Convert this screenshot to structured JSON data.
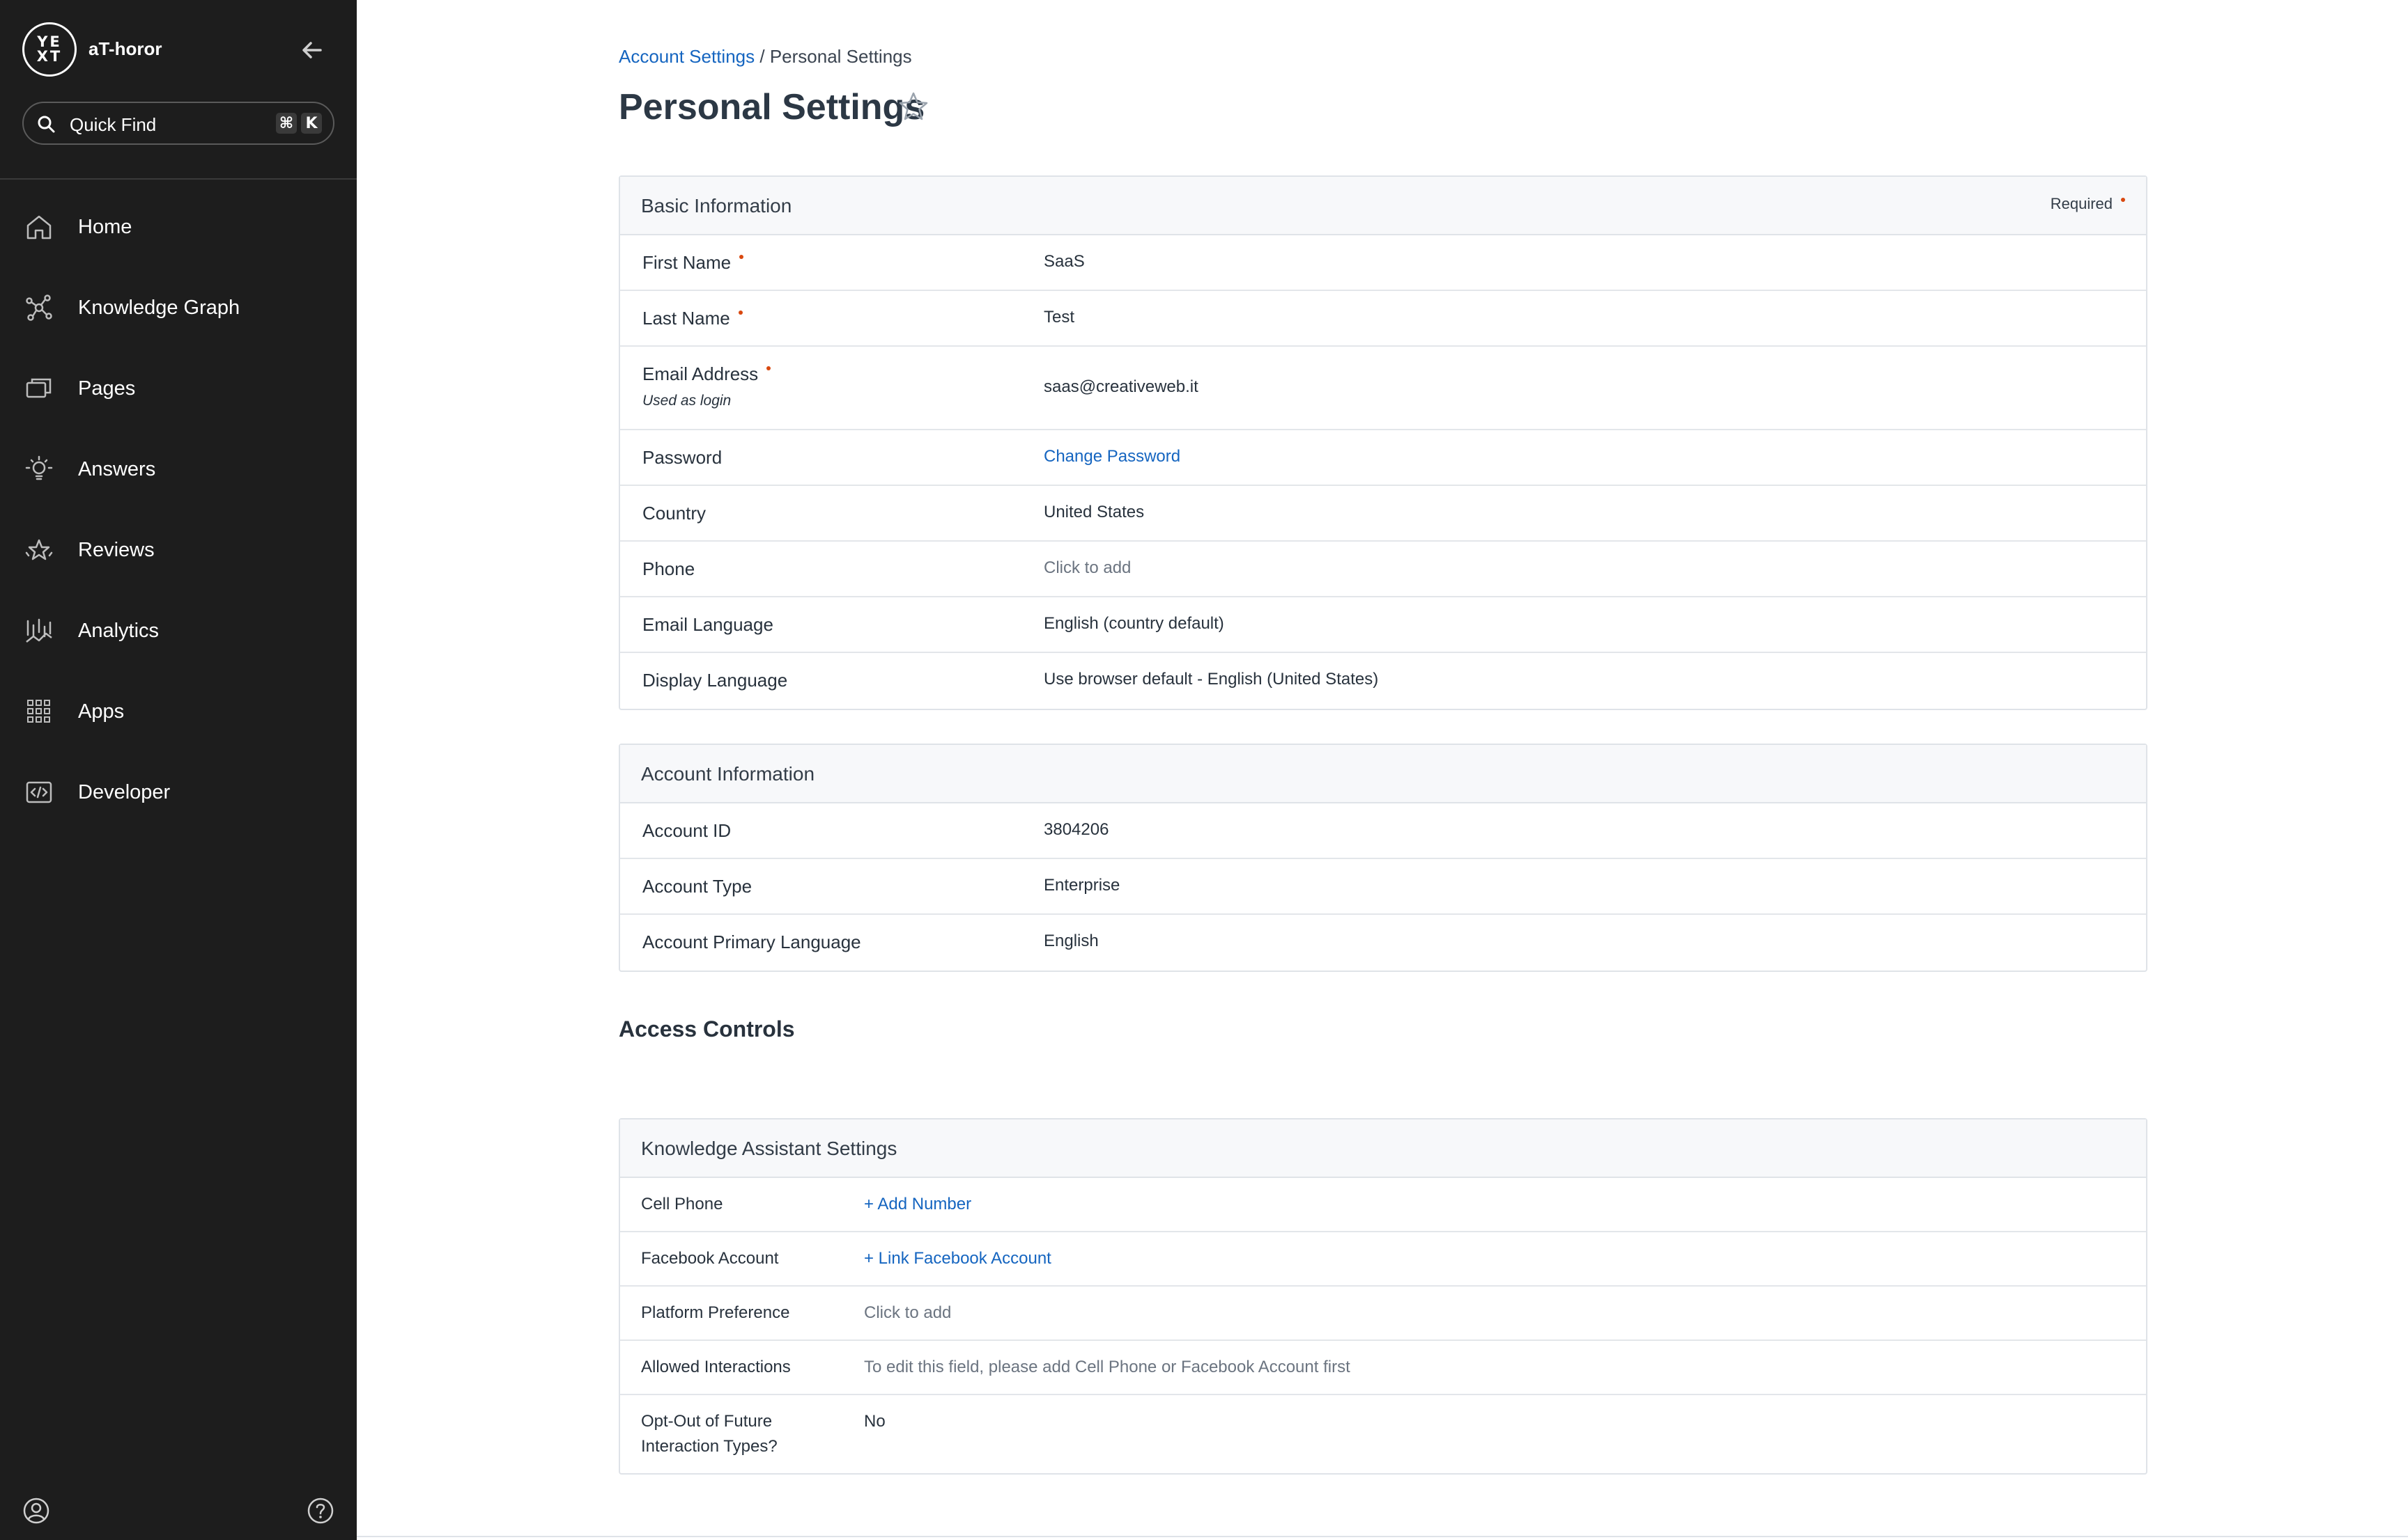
{
  "sidebar": {
    "logo_text": "YEXT",
    "account_name": "aT-horor",
    "quick_find": {
      "placeholder": "Quick Find",
      "keys": [
        "⌘",
        "K"
      ]
    },
    "nav": [
      {
        "label": "Home",
        "icon": "home-icon"
      },
      {
        "label": "Knowledge Graph",
        "icon": "knowledge-graph-icon"
      },
      {
        "label": "Pages",
        "icon": "pages-icon"
      },
      {
        "label": "Answers",
        "icon": "lightbulb-icon"
      },
      {
        "label": "Reviews",
        "icon": "stars-icon"
      },
      {
        "label": "Analytics",
        "icon": "analytics-icon"
      },
      {
        "label": "Apps",
        "icon": "grid-icon"
      },
      {
        "label": "Developer",
        "icon": "code-icon"
      }
    ]
  },
  "breadcrumb": {
    "parent": "Account Settings",
    "separator": "/",
    "current": "Personal Settings"
  },
  "page_title": "Personal Settings",
  "basic_info": {
    "title": "Basic Information",
    "required_label": "Required",
    "rows": [
      {
        "label": "First Name",
        "value": "SaaS"
      },
      {
        "label": "Last Name",
        "value": "Test"
      },
      {
        "label": "Email Address",
        "sublabel": "Used as login",
        "value": "saas@creativeweb.it"
      },
      {
        "label": "Password",
        "value": "Change Password"
      },
      {
        "label": "Country",
        "value": "United States"
      },
      {
        "label": "Phone",
        "value": "Click to add"
      },
      {
        "label": "Email Language",
        "value": "English (country default)"
      },
      {
        "label": "Display Language",
        "value": "Use browser default - English (United States)"
      }
    ]
  },
  "account_info": {
    "title": "Account Information",
    "rows": [
      {
        "label": "Account ID",
        "value": "3804206"
      },
      {
        "label": "Account Type",
        "value": "Enterprise"
      },
      {
        "label": "Account Primary Language",
        "value": "English"
      }
    ]
  },
  "access_controls": {
    "title": "Access Controls"
  },
  "knowledge_assistant": {
    "title": "Knowledge Assistant Settings",
    "rows": [
      {
        "label": "Cell Phone",
        "value": "+ Add Number"
      },
      {
        "label": "Facebook Account",
        "value": "+ Link Facebook Account"
      },
      {
        "label": "Platform Preference",
        "value": "Click to add"
      },
      {
        "label": "Allowed Interactions",
        "value": "To edit this field, please add Cell Phone or Facebook Account first"
      },
      {
        "label": "Opt-Out of Future Interaction Types?",
        "value": "No"
      }
    ]
  },
  "colors": {
    "sidebar_bg": "#1d1d1d",
    "link": "#1565c0",
    "required_dot": "#d9480f"
  }
}
